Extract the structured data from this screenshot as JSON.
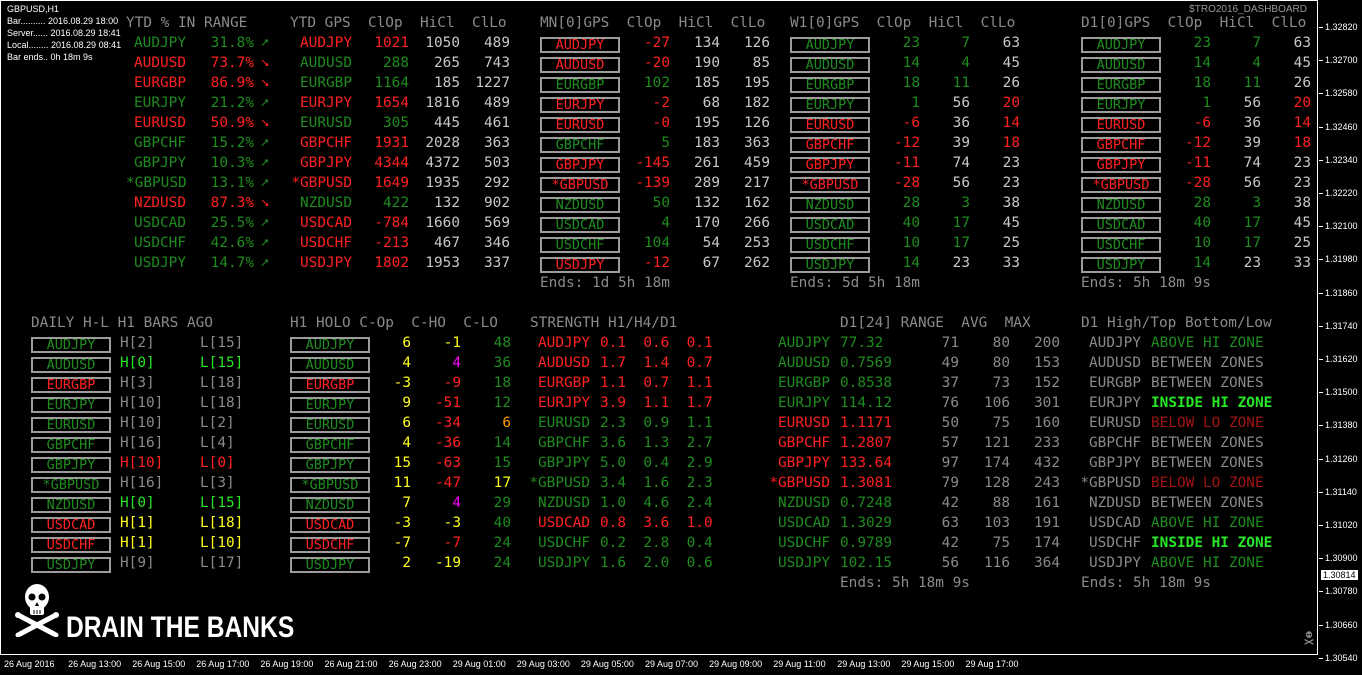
{
  "window": {
    "title": "GBPUSD,H1",
    "dashboard_label": "$TRO2016_DASHBOARD"
  },
  "info": [
    "Bar.......... 2016.08.29 18:00",
    "Server...... 2016.08.29 18:41",
    "Local........ 2016.08.29 08:41",
    "Bar ends.. 0h 18m 9s"
  ],
  "headers": {
    "ytd_range": "YTD % IN RANGE",
    "ytd_gps": "YTD GPS  ClOp  HiCl  ClLo",
    "mn": "MN[0]GPS  ClOp  HiCl  ClLo",
    "w1": "W1[0]GPS  ClOp  HiCl  ClLo",
    "d1": "D1[0]GPS  ClOp  HiCl  ClLo",
    "daily_hl": "DAILY H-L H1 BARS AGO",
    "h1holo": "H1 HOLO C-Op  C-HO  C-LO",
    "strength": "STRENGTH H1/H4/D1",
    "d1range": "D1[24] RANGE  AVG  MAX",
    "d1zone": "D1 High/Top Bottom/Low"
  },
  "ends": {
    "mn": "Ends: 1d 5h 18m",
    "w1": "Ends: 5d 5h 18m",
    "d1": "Ends: 5h 18m 9s",
    "range": "Ends: 5h 18m 9s",
    "zone": "Ends: 5h 18m 9s"
  },
  "ytd_range": [
    {
      "sym": "AUDJPY",
      "pct": "31.8%",
      "c": "gr",
      "up": true
    },
    {
      "sym": "AUDUSD",
      "pct": "73.7%",
      "c": "rd",
      "up": false
    },
    {
      "sym": "EURGBP",
      "pct": "86.9%",
      "c": "rd",
      "up": false
    },
    {
      "sym": "EURJPY",
      "pct": "21.2%",
      "c": "gr",
      "up": true
    },
    {
      "sym": "EURUSD",
      "pct": "50.9%",
      "c": "rd",
      "up": false
    },
    {
      "sym": "GBPCHF",
      "pct": "15.2%",
      "c": "gr",
      "up": true
    },
    {
      "sym": "GBPJPY",
      "pct": "10.3%",
      "c": "gr",
      "up": true
    },
    {
      "sym": "*GBPUSD",
      "pct": "13.1%",
      "c": "gr",
      "up": true
    },
    {
      "sym": "NZDUSD",
      "pct": "87.3%",
      "c": "rd",
      "up": false
    },
    {
      "sym": "USDCAD",
      "pct": "25.5%",
      "c": "gr",
      "up": true
    },
    {
      "sym": "USDCHF",
      "pct": "42.6%",
      "c": "gr",
      "up": true
    },
    {
      "sym": "USDJPY",
      "pct": "14.7%",
      "c": "gr",
      "up": true
    }
  ],
  "ytd_gps": [
    {
      "sym": "AUDJPY",
      "c": "rd",
      "clop": "1021",
      "hicl": "1050",
      "cllo": "489"
    },
    {
      "sym": "AUDUSD",
      "c": "gr",
      "clop": "288",
      "hicl": "265",
      "cllo": "743"
    },
    {
      "sym": "EURGBP",
      "c": "gr",
      "clop": "1164",
      "hicl": "185",
      "cllo": "1227"
    },
    {
      "sym": "EURJPY",
      "c": "rd",
      "clop": "1654",
      "hicl": "1816",
      "cllo": "489"
    },
    {
      "sym": "EURUSD",
      "c": "gr",
      "clop": "305",
      "hicl": "445",
      "cllo": "461"
    },
    {
      "sym": "GBPCHF",
      "c": "rd",
      "clop": "1931",
      "hicl": "2028",
      "cllo": "363"
    },
    {
      "sym": "GBPJPY",
      "c": "rd",
      "clop": "4344",
      "hicl": "4372",
      "cllo": "503"
    },
    {
      "sym": "*GBPUSD",
      "c": "rd",
      "clop": "1649",
      "hicl": "1935",
      "cllo": "292"
    },
    {
      "sym": "NZDUSD",
      "c": "gr",
      "clop": "422",
      "hicl": "132",
      "cllo": "902"
    },
    {
      "sym": "USDCAD",
      "c": "rd",
      "clop": "-784",
      "hicl": "1660",
      "cllo": "569"
    },
    {
      "sym": "USDCHF",
      "c": "rd",
      "clop": "-213",
      "hicl": "467",
      "cllo": "346"
    },
    {
      "sym": "USDJPY",
      "c": "rd",
      "clop": "1802",
      "hicl": "1953",
      "cllo": "337"
    }
  ],
  "mn": [
    {
      "sym": "AUDJPY",
      "c": "rd",
      "clop": "-27",
      "hicl": "134",
      "cllo": "126",
      "lc": "wh"
    },
    {
      "sym": "AUDUSD",
      "c": "rd",
      "clop": "-20",
      "hicl": "190",
      "cllo": "85",
      "lc": "wh"
    },
    {
      "sym": "EURGBP",
      "c": "gr",
      "clop": "102",
      "hicl": "185",
      "cllo": "195",
      "lc": "wh"
    },
    {
      "sym": "EURJPY",
      "c": "rd",
      "clop": "-2",
      "hicl": "68",
      "cllo": "182",
      "lc": "wh"
    },
    {
      "sym": "EURUSD",
      "c": "rd",
      "clop": "-0",
      "hicl": "195",
      "cllo": "126",
      "lc": "wh"
    },
    {
      "sym": "GBPCHF",
      "c": "gr",
      "clop": "5",
      "hicl": "183",
      "cllo": "363",
      "lc": "wh"
    },
    {
      "sym": "GBPJPY",
      "c": "rd",
      "clop": "-145",
      "hicl": "261",
      "cllo": "459",
      "lc": "wh"
    },
    {
      "sym": "*GBPUSD",
      "c": "rd",
      "clop": "-139",
      "hicl": "289",
      "cllo": "217",
      "lc": "wh"
    },
    {
      "sym": "NZDUSD",
      "c": "gr",
      "clop": "50",
      "hicl": "132",
      "cllo": "162",
      "lc": "wh"
    },
    {
      "sym": "USDCAD",
      "c": "gr",
      "clop": "4",
      "hicl": "170",
      "cllo": "266",
      "lc": "wh"
    },
    {
      "sym": "USDCHF",
      "c": "gr",
      "clop": "104",
      "hicl": "54",
      "cllo": "253",
      "lc": "wh"
    },
    {
      "sym": "USDJPY",
      "c": "rd",
      "clop": "-12",
      "hicl": "67",
      "cllo": "262",
      "lc": "wh"
    }
  ],
  "w1": [
    {
      "sym": "AUDJPY",
      "c": "gr",
      "clop": "23",
      "hicl": "7",
      "cllo": "63",
      "hc": "gr",
      "lc": "wh"
    },
    {
      "sym": "AUDUSD",
      "c": "gr",
      "clop": "14",
      "hicl": "4",
      "cllo": "45",
      "hc": "gr",
      "lc": "wh"
    },
    {
      "sym": "EURGBP",
      "c": "gr",
      "clop": "18",
      "hicl": "11",
      "cllo": "26",
      "hc": "gr",
      "lc": "wh"
    },
    {
      "sym": "EURJPY",
      "c": "gr",
      "clop": "1",
      "hicl": "56",
      "cllo": "20",
      "hc": "wh",
      "lc": "rd"
    },
    {
      "sym": "EURUSD",
      "c": "rd",
      "clop": "-6",
      "hicl": "36",
      "cllo": "14",
      "hc": "wh",
      "lc": "rd"
    },
    {
      "sym": "GBPCHF",
      "c": "rd",
      "clop": "-12",
      "hicl": "39",
      "cllo": "18",
      "hc": "wh",
      "lc": "rd"
    },
    {
      "sym": "GBPJPY",
      "c": "rd",
      "clop": "-11",
      "hicl": "74",
      "cllo": "23",
      "hc": "wh",
      "lc": "wh"
    },
    {
      "sym": "*GBPUSD",
      "c": "rd",
      "clop": "-28",
      "hicl": "56",
      "cllo": "23",
      "hc": "wh",
      "lc": "wh"
    },
    {
      "sym": "NZDUSD",
      "c": "gr",
      "clop": "28",
      "hicl": "3",
      "cllo": "38",
      "hc": "gr",
      "lc": "wh"
    },
    {
      "sym": "USDCAD",
      "c": "gr",
      "clop": "40",
      "hicl": "17",
      "cllo": "45",
      "hc": "gr",
      "lc": "wh"
    },
    {
      "sym": "USDCHF",
      "c": "gr",
      "clop": "10",
      "hicl": "17",
      "cllo": "25",
      "hc": "gr",
      "lc": "wh"
    },
    {
      "sym": "USDJPY",
      "c": "gr",
      "clop": "14",
      "hicl": "23",
      "cllo": "33",
      "hc": "wh",
      "lc": "wh"
    }
  ],
  "d1": [
    {
      "sym": "AUDJPY",
      "c": "gr",
      "clop": "23",
      "hicl": "7",
      "cllo": "63",
      "hc": "gr",
      "lc": "wh"
    },
    {
      "sym": "AUDUSD",
      "c": "gr",
      "clop": "14",
      "hicl": "4",
      "cllo": "45",
      "hc": "gr",
      "lc": "wh"
    },
    {
      "sym": "EURGBP",
      "c": "gr",
      "clop": "18",
      "hicl": "11",
      "cllo": "26",
      "hc": "gr",
      "lc": "wh"
    },
    {
      "sym": "EURJPY",
      "c": "gr",
      "clop": "1",
      "hicl": "56",
      "cllo": "20",
      "hc": "wh",
      "lc": "rd"
    },
    {
      "sym": "EURUSD",
      "c": "rd",
      "clop": "-6",
      "hicl": "36",
      "cllo": "14",
      "hc": "wh",
      "lc": "rd"
    },
    {
      "sym": "GBPCHF",
      "c": "rd",
      "clop": "-12",
      "hicl": "39",
      "cllo": "18",
      "hc": "wh",
      "lc": "rd"
    },
    {
      "sym": "GBPJPY",
      "c": "rd",
      "clop": "-11",
      "hicl": "74",
      "cllo": "23",
      "hc": "wh",
      "lc": "wh"
    },
    {
      "sym": "*GBPUSD",
      "c": "rd",
      "clop": "-28",
      "hicl": "56",
      "cllo": "23",
      "hc": "wh",
      "lc": "wh"
    },
    {
      "sym": "NZDUSD",
      "c": "gr",
      "clop": "28",
      "hicl": "3",
      "cllo": "38",
      "hc": "gr",
      "lc": "wh"
    },
    {
      "sym": "USDCAD",
      "c": "gr",
      "clop": "40",
      "hicl": "17",
      "cllo": "45",
      "hc": "gr",
      "lc": "wh"
    },
    {
      "sym": "USDCHF",
      "c": "gr",
      "clop": "10",
      "hicl": "17",
      "cllo": "25",
      "hc": "gr",
      "lc": "wh"
    },
    {
      "sym": "USDJPY",
      "c": "gr",
      "clop": "14",
      "hicl": "23",
      "cllo": "33",
      "hc": "wh",
      "lc": "wh"
    }
  ],
  "daily_hl": [
    {
      "sym": "AUDJPY",
      "c": "gr",
      "h": "H[2]",
      "hc": "gy",
      "l": "L[15]",
      "lc": "gy"
    },
    {
      "sym": "AUDUSD",
      "c": "gr",
      "h": "H[0]",
      "hc": "lg",
      "l": "L[15]",
      "lc": "lg"
    },
    {
      "sym": "EURGBP",
      "c": "rd",
      "h": "H[3]",
      "hc": "gy",
      "l": "L[18]",
      "lc": "gy"
    },
    {
      "sym": "EURJPY",
      "c": "gr",
      "h": "H[10]",
      "hc": "gy",
      "l": "L[18]",
      "lc": "gy"
    },
    {
      "sym": "EURUSD",
      "c": "gr",
      "h": "H[10]",
      "hc": "gy",
      "l": "L[2]",
      "lc": "gy"
    },
    {
      "sym": "GBPCHF",
      "c": "gr",
      "h": "H[16]",
      "hc": "gy",
      "l": "L[4]",
      "lc": "gy"
    },
    {
      "sym": "GBPJPY",
      "c": "gr",
      "h": "H[10]",
      "hc": "rd",
      "l": "L[0]",
      "lc": "rd"
    },
    {
      "sym": "*GBPUSD",
      "c": "gr",
      "h": "H[16]",
      "hc": "gy",
      "l": "L[3]",
      "lc": "gy"
    },
    {
      "sym": "NZDUSD",
      "c": "gr",
      "h": "H[0]",
      "hc": "lg",
      "l": "L[15]",
      "lc": "lg"
    },
    {
      "sym": "USDCAD",
      "c": "rd",
      "h": "H[1]",
      "hc": "yl",
      "l": "L[18]",
      "lc": "yl"
    },
    {
      "sym": "USDCHF",
      "c": "rd",
      "h": "H[1]",
      "hc": "yl",
      "l": "L[10]",
      "lc": "yl"
    },
    {
      "sym": "USDJPY",
      "c": "gr",
      "h": "H[9]",
      "hc": "gy",
      "l": "L[17]",
      "lc": "gy"
    }
  ],
  "h1holo": [
    {
      "sym": "AUDJPY",
      "c": "gr",
      "cop": "6",
      "copc": "yl",
      "cho": "-1",
      "choc": "yl",
      "clo": "48",
      "cloc": "gr"
    },
    {
      "sym": "AUDUSD",
      "c": "gr",
      "cop": "4",
      "copc": "yl",
      "cho": "4",
      "choc": "mg",
      "clo": "36",
      "cloc": "gr"
    },
    {
      "sym": "EURGBP",
      "c": "rd",
      "cop": "-3",
      "copc": "yl",
      "cho": "-9",
      "choc": "rd",
      "clo": "18",
      "cloc": "gr"
    },
    {
      "sym": "EURJPY",
      "c": "gr",
      "cop": "9",
      "copc": "yl",
      "cho": "-51",
      "choc": "rd",
      "clo": "12",
      "cloc": "gr"
    },
    {
      "sym": "EURUSD",
      "c": "gr",
      "cop": "6",
      "copc": "yl",
      "cho": "-34",
      "choc": "rd",
      "clo": "6",
      "cloc": "or"
    },
    {
      "sym": "GBPCHF",
      "c": "gr",
      "cop": "4",
      "copc": "yl",
      "cho": "-36",
      "choc": "rd",
      "clo": "14",
      "cloc": "gr"
    },
    {
      "sym": "GBPJPY",
      "c": "gr",
      "cop": "15",
      "copc": "yl",
      "cho": "-63",
      "choc": "rd",
      "clo": "15",
      "cloc": "gr"
    },
    {
      "sym": "*GBPUSD",
      "c": "gr",
      "cop": "11",
      "copc": "yl",
      "cho": "-47",
      "choc": "rd",
      "clo": "17",
      "cloc": "yl"
    },
    {
      "sym": "NZDUSD",
      "c": "gr",
      "cop": "7",
      "copc": "yl",
      "cho": "4",
      "choc": "mg",
      "clo": "29",
      "cloc": "gr"
    },
    {
      "sym": "USDCAD",
      "c": "rd",
      "cop": "-3",
      "copc": "yl",
      "cho": "-3",
      "choc": "yl",
      "clo": "40",
      "cloc": "gr"
    },
    {
      "sym": "USDCHF",
      "c": "rd",
      "cop": "-7",
      "copc": "yl",
      "cho": "-7",
      "choc": "rd",
      "clo": "24",
      "cloc": "gr"
    },
    {
      "sym": "USDJPY",
      "c": "gr",
      "cop": "2",
      "copc": "yl",
      "cho": "-19",
      "choc": "yl",
      "clo": "24",
      "cloc": "gr"
    }
  ],
  "strength": [
    {
      "sym": "AUDJPY",
      "c": "rd",
      "v": "0.1  0.6  0.1"
    },
    {
      "sym": "AUDUSD",
      "c": "rd",
      "v": "1.7  1.4  0.7"
    },
    {
      "sym": "EURGBP",
      "c": "rd",
      "v": "1.1  0.7  1.1"
    },
    {
      "sym": "EURJPY",
      "c": "rd",
      "v": "3.9  1.1  1.7"
    },
    {
      "sym": "EURUSD",
      "c": "gr",
      "v": "2.3  0.9  1.1"
    },
    {
      "sym": "GBPCHF",
      "c": "gr",
      "v": "3.6  1.3  2.7"
    },
    {
      "sym": "GBPJPY",
      "c": "gr",
      "v": "5.0  0.4  2.9"
    },
    {
      "sym": "*GBPUSD",
      "c": "gr",
      "v": "3.4  1.6  2.3"
    },
    {
      "sym": "NZDUSD",
      "c": "gr",
      "v": "1.0  4.6  2.4"
    },
    {
      "sym": "USDCAD",
      "c": "rd",
      "v": "0.8  3.6  1.0"
    },
    {
      "sym": "USDCHF",
      "c": "gr",
      "v": "0.2  2.8  0.4"
    },
    {
      "sym": "USDJPY",
      "c": "gr",
      "v": "1.6  2.0  0.6"
    }
  ],
  "d1range": [
    {
      "sym": "AUDJPY",
      "c": "gr",
      "price": "77.32",
      "range": "71",
      "avg": "80",
      "max": "200"
    },
    {
      "sym": "AUDUSD",
      "c": "gr",
      "price": "0.7569",
      "range": "49",
      "avg": "80",
      "max": "153"
    },
    {
      "sym": "EURGBP",
      "c": "gr",
      "price": "0.8538",
      "range": "37",
      "avg": "73",
      "max": "152"
    },
    {
      "sym": "EURJPY",
      "c": "gr",
      "price": "114.12",
      "range": "76",
      "avg": "106",
      "max": "301"
    },
    {
      "sym": "EURUSD",
      "c": "rd",
      "price": "1.1171",
      "range": "50",
      "avg": "75",
      "max": "160"
    },
    {
      "sym": "GBPCHF",
      "c": "rd",
      "price": "1.2807",
      "range": "57",
      "avg": "121",
      "max": "233"
    },
    {
      "sym": "GBPJPY",
      "c": "rd",
      "price": "133.64",
      "range": "97",
      "avg": "174",
      "max": "432"
    },
    {
      "sym": "*GBPUSD",
      "c": "rd",
      "price": "1.3081",
      "range": "79",
      "avg": "128",
      "max": "243"
    },
    {
      "sym": "NZDUSD",
      "c": "gr",
      "price": "0.7248",
      "range": "42",
      "avg": "88",
      "max": "161"
    },
    {
      "sym": "USDCAD",
      "c": "gr",
      "price": "1.3029",
      "range": "63",
      "avg": "103",
      "max": "191"
    },
    {
      "sym": "USDCHF",
      "c": "gr",
      "price": "0.9789",
      "range": "42",
      "avg": "75",
      "max": "174"
    },
    {
      "sym": "USDJPY",
      "c": "gr",
      "price": "102.15",
      "range": "56",
      "avg": "116",
      "max": "364"
    }
  ],
  "d1zone": [
    {
      "sym": "AUDJPY",
      "zone": "ABOVE HI ZONE",
      "zc": "gr"
    },
    {
      "sym": "AUDUSD",
      "zone": "BETWEEN ZONES",
      "zc": "gy"
    },
    {
      "sym": "EURGBP",
      "zone": "BETWEEN ZONES",
      "zc": "gy"
    },
    {
      "sym": "EURJPY",
      "zone": "INSIDE HI ZONE",
      "zc": "lg"
    },
    {
      "sym": "EURUSD",
      "zone": "BELOW LO ZONE",
      "zc": "rdk"
    },
    {
      "sym": "GBPCHF",
      "zone": "BETWEEN ZONES",
      "zc": "gy"
    },
    {
      "sym": "GBPJPY",
      "zone": "BETWEEN ZONES",
      "zc": "gy"
    },
    {
      "sym": "*GBPUSD",
      "zone": "BELOW LO ZONE",
      "zc": "rdk"
    },
    {
      "sym": "NZDUSD",
      "zone": "BETWEEN ZONES",
      "zc": "gy"
    },
    {
      "sym": "USDCAD",
      "zone": "ABOVE HI ZONE",
      "zc": "gr"
    },
    {
      "sym": "USDCHF",
      "zone": "INSIDE HI ZONE",
      "zc": "lg"
    },
    {
      "sym": "USDJPY",
      "zone": "ABOVE HI ZONE",
      "zc": "gr"
    }
  ],
  "banner": "DRAIN THE BANKS",
  "y_axis": [
    "1.32820",
    "1.32700",
    "1.32580",
    "1.32460",
    "1.32340",
    "1.32220",
    "1.32100",
    "1.31980",
    "1.31860",
    "1.31740",
    "1.31620",
    "1.31500",
    "1.31380",
    "1.31260",
    "1.31140",
    "1.31020",
    "1.30900",
    "1.30780",
    "1.30660",
    "1.30540"
  ],
  "current_price": "1.30814",
  "x_axis": [
    "26 Aug 2016",
    "26 Aug 13:00",
    "26 Aug 15:00",
    "26 Aug 17:00",
    "26 Aug 19:00",
    "26 Aug 21:00",
    "26 Aug 23:00",
    "29 Aug 01:00",
    "29 Aug 03:00",
    "29 Aug 05:00",
    "29 Aug 07:00",
    "29 Aug 09:00",
    "29 Aug 11:00",
    "29 Aug 13:00",
    "29 Aug 15:00",
    "29 Aug 17:00"
  ],
  "colors": {
    "green": "#1e8c1e",
    "red": "#ff2020",
    "yellow": "#ffff1a",
    "magenta": "#ff00ff",
    "grey": "#8a8a8a",
    "bright_green": "#26e626",
    "orange": "#ff9900"
  },
  "icons": {
    "skull": "skull-crossbones-icon",
    "up_arrow": "arrow-up-icon",
    "down_arrow": "arrow-down-icon"
  }
}
